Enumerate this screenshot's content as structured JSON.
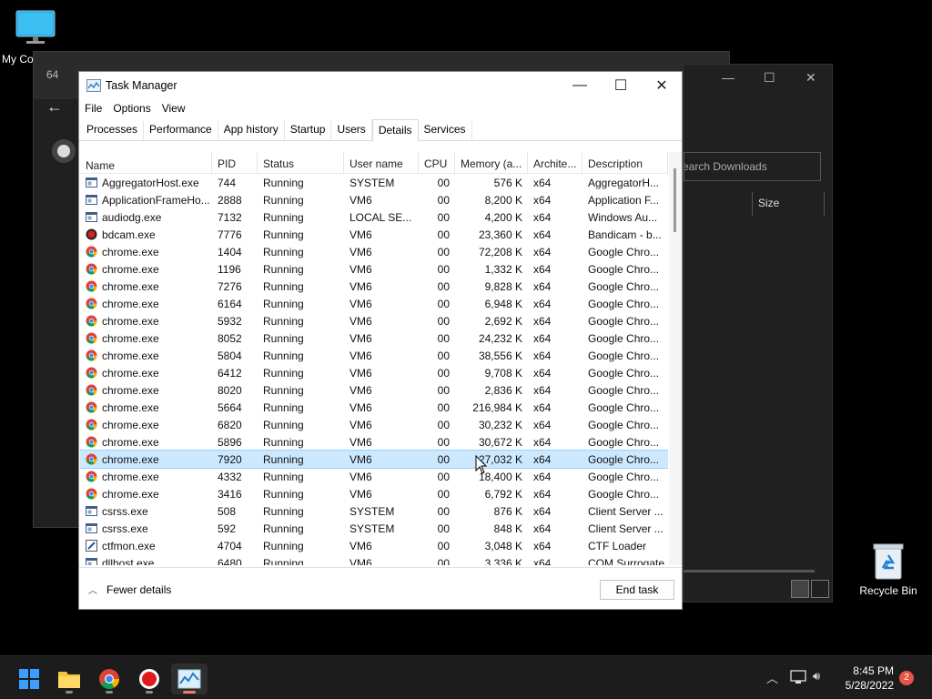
{
  "desktop": {
    "my_computer_label": "My Computer",
    "recycle_bin_label": "Recycle Bin"
  },
  "bg_window": {
    "tab_title_prefix": "64",
    "search_placeholder": "Search Downloads",
    "size_header": "Size"
  },
  "task_manager": {
    "title": "Task Manager",
    "menu": [
      "File",
      "Options",
      "View"
    ],
    "tabs": [
      "Processes",
      "Performance",
      "App history",
      "Startup",
      "Users",
      "Details",
      "Services"
    ],
    "active_tab": "Details",
    "columns": [
      "Name",
      "PID",
      "Status",
      "User name",
      "CPU",
      "Memory (a...",
      "Archite...",
      "Description"
    ],
    "rows": [
      {
        "name": "AggregatorHost.exe",
        "pid": "744",
        "status": "Running",
        "user": "SYSTEM",
        "cpu": "00",
        "mem": "576 K",
        "arch": "x64",
        "desc": "AggregatorH...",
        "icon": "window-icon"
      },
      {
        "name": "ApplicationFrameHo...",
        "pid": "2888",
        "status": "Running",
        "user": "VM6",
        "cpu": "00",
        "mem": "8,200 K",
        "arch": "x64",
        "desc": "Application F...",
        "icon": "window-icon"
      },
      {
        "name": "audiodg.exe",
        "pid": "7132",
        "status": "Running",
        "user": "LOCAL SE...",
        "cpu": "00",
        "mem": "4,200 K",
        "arch": "x64",
        "desc": "Windows Au...",
        "icon": "window-icon"
      },
      {
        "name": "bdcam.exe",
        "pid": "7776",
        "status": "Running",
        "user": "VM6",
        "cpu": "00",
        "mem": "23,360 K",
        "arch": "x64",
        "desc": "Bandicam - b...",
        "icon": "record-icon"
      },
      {
        "name": "chrome.exe",
        "pid": "1404",
        "status": "Running",
        "user": "VM6",
        "cpu": "00",
        "mem": "72,208 K",
        "arch": "x64",
        "desc": "Google Chro...",
        "icon": "chrome-icon"
      },
      {
        "name": "chrome.exe",
        "pid": "1196",
        "status": "Running",
        "user": "VM6",
        "cpu": "00",
        "mem": "1,332 K",
        "arch": "x64",
        "desc": "Google Chro...",
        "icon": "chrome-icon"
      },
      {
        "name": "chrome.exe",
        "pid": "7276",
        "status": "Running",
        "user": "VM6",
        "cpu": "00",
        "mem": "9,828 K",
        "arch": "x64",
        "desc": "Google Chro...",
        "icon": "chrome-icon"
      },
      {
        "name": "chrome.exe",
        "pid": "6164",
        "status": "Running",
        "user": "VM6",
        "cpu": "00",
        "mem": "6,948 K",
        "arch": "x64",
        "desc": "Google Chro...",
        "icon": "chrome-icon"
      },
      {
        "name": "chrome.exe",
        "pid": "5932",
        "status": "Running",
        "user": "VM6",
        "cpu": "00",
        "mem": "2,692 K",
        "arch": "x64",
        "desc": "Google Chro...",
        "icon": "chrome-icon"
      },
      {
        "name": "chrome.exe",
        "pid": "8052",
        "status": "Running",
        "user": "VM6",
        "cpu": "00",
        "mem": "24,232 K",
        "arch": "x64",
        "desc": "Google Chro...",
        "icon": "chrome-icon"
      },
      {
        "name": "chrome.exe",
        "pid": "5804",
        "status": "Running",
        "user": "VM6",
        "cpu": "00",
        "mem": "38,556 K",
        "arch": "x64",
        "desc": "Google Chro...",
        "icon": "chrome-icon"
      },
      {
        "name": "chrome.exe",
        "pid": "6412",
        "status": "Running",
        "user": "VM6",
        "cpu": "00",
        "mem": "9,708 K",
        "arch": "x64",
        "desc": "Google Chro...",
        "icon": "chrome-icon"
      },
      {
        "name": "chrome.exe",
        "pid": "8020",
        "status": "Running",
        "user": "VM6",
        "cpu": "00",
        "mem": "2,836 K",
        "arch": "x64",
        "desc": "Google Chro...",
        "icon": "chrome-icon"
      },
      {
        "name": "chrome.exe",
        "pid": "5664",
        "status": "Running",
        "user": "VM6",
        "cpu": "00",
        "mem": "216,984 K",
        "arch": "x64",
        "desc": "Google Chro...",
        "icon": "chrome-icon"
      },
      {
        "name": "chrome.exe",
        "pid": "6820",
        "status": "Running",
        "user": "VM6",
        "cpu": "00",
        "mem": "30,232 K",
        "arch": "x64",
        "desc": "Google Chro...",
        "icon": "chrome-icon"
      },
      {
        "name": "chrome.exe",
        "pid": "5896",
        "status": "Running",
        "user": "VM6",
        "cpu": "00",
        "mem": "30,672 K",
        "arch": "x64",
        "desc": "Google Chro...",
        "icon": "chrome-icon"
      },
      {
        "name": "chrome.exe",
        "pid": "7920",
        "status": "Running",
        "user": "VM6",
        "cpu": "00",
        "mem": "27,032 K",
        "arch": "x64",
        "desc": "Google Chro...",
        "icon": "chrome-icon",
        "selected": true
      },
      {
        "name": "chrome.exe",
        "pid": "4332",
        "status": "Running",
        "user": "VM6",
        "cpu": "00",
        "mem": "18,400 K",
        "arch": "x64",
        "desc": "Google Chro...",
        "icon": "chrome-icon"
      },
      {
        "name": "chrome.exe",
        "pid": "3416",
        "status": "Running",
        "user": "VM6",
        "cpu": "00",
        "mem": "6,792 K",
        "arch": "x64",
        "desc": "Google Chro...",
        "icon": "chrome-icon"
      },
      {
        "name": "csrss.exe",
        "pid": "508",
        "status": "Running",
        "user": "SYSTEM",
        "cpu": "00",
        "mem": "876 K",
        "arch": "x64",
        "desc": "Client Server ...",
        "icon": "window-icon"
      },
      {
        "name": "csrss.exe",
        "pid": "592",
        "status": "Running",
        "user": "SYSTEM",
        "cpu": "00",
        "mem": "848 K",
        "arch": "x64",
        "desc": "Client Server ...",
        "icon": "window-icon"
      },
      {
        "name": "ctfmon.exe",
        "pid": "4704",
        "status": "Running",
        "user": "VM6",
        "cpu": "00",
        "mem": "3,048 K",
        "arch": "x64",
        "desc": "CTF Loader",
        "icon": "pen-icon"
      },
      {
        "name": "dllhost.exe",
        "pid": "6480",
        "status": "Running",
        "user": "VM6",
        "cpu": "00",
        "mem": "3,336 K",
        "arch": "x64",
        "desc": "COM Surrogate",
        "icon": "window-icon"
      }
    ],
    "fewer_details": "Fewer details",
    "end_task": "End task"
  },
  "taskbar": {
    "items": [
      "start-icon",
      "file-explorer-icon",
      "chrome-icon",
      "bandicam-icon",
      "task-manager-icon"
    ],
    "time": "8:45 PM",
    "date": "5/28/2022",
    "notification_count": "2"
  },
  "colors": {
    "selection": "#cce8ff",
    "taskbar": "#1c1c1c",
    "accent_active": "#f47b6b"
  }
}
